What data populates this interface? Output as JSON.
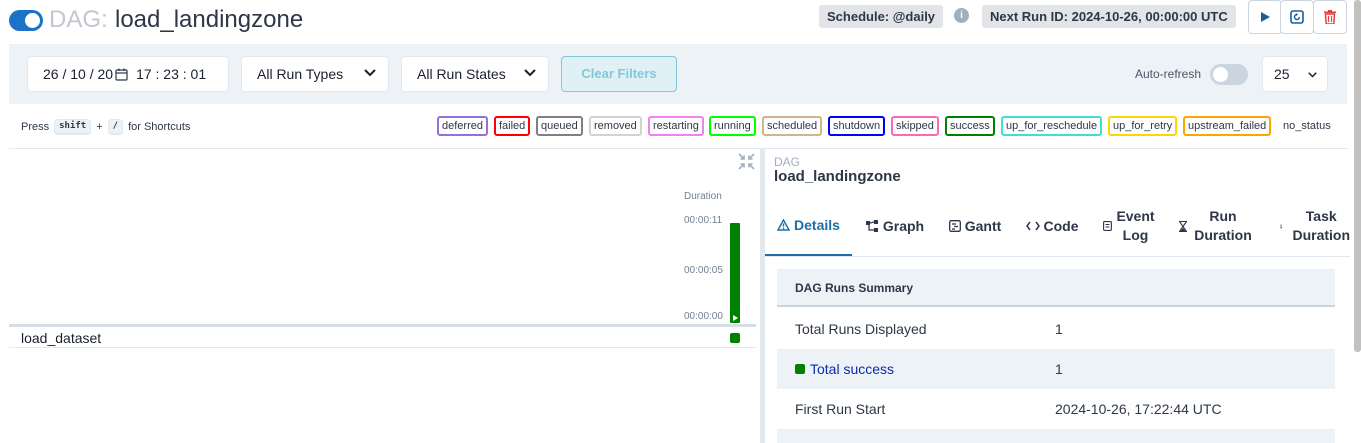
{
  "header": {
    "dag_prefix": "DAG:",
    "dag_name": "load_landingzone",
    "schedule": "Schedule: @daily",
    "next_run": "Next Run ID: 2024-10-26, 00:00:00 UTC",
    "info_glyph": "i",
    "icons": [
      "play-icon",
      "refresh-icon",
      "trash-icon"
    ]
  },
  "filters": {
    "date_value": "26 / 10 / 20",
    "time_value": "17 : 23 : 01",
    "run_types": "All Run Types",
    "run_states": "All Run States",
    "clear": "Clear Filters",
    "auto_refresh": "Auto-refresh",
    "page_size": "25"
  },
  "shortcuts": {
    "prefix": "Press",
    "key1": "shift",
    "plus": "+",
    "key2": "/",
    "suffix": "for Shortcuts"
  },
  "legend": [
    {
      "label": "deferred",
      "color": "#9370db"
    },
    {
      "label": "failed",
      "color": "#ff0000"
    },
    {
      "label": "queued",
      "color": "#808080"
    },
    {
      "label": "removed",
      "color": "#d3d3d3"
    },
    {
      "label": "restarting",
      "color": "#ee82ee"
    },
    {
      "label": "running",
      "color": "#00ff00"
    },
    {
      "label": "scheduled",
      "color": "#d2b48c"
    },
    {
      "label": "shutdown",
      "color": "#0000ff"
    },
    {
      "label": "skipped",
      "color": "#ff69b4"
    },
    {
      "label": "success",
      "color": "#008000"
    },
    {
      "label": "up_for_reschedule",
      "color": "#40e0d0"
    },
    {
      "label": "up_for_retry",
      "color": "#ffd700"
    },
    {
      "label": "upstream_failed",
      "color": "#ffa500"
    }
  ],
  "no_status": "no_status",
  "grid": {
    "duration_label": "Duration",
    "ticks": [
      "00:00:11",
      "00:00:05",
      "00:00:00"
    ],
    "run_duration_fraction": 1.0,
    "tasks": [
      {
        "name": "load_dataset",
        "state": "success"
      }
    ]
  },
  "details": {
    "crumb_label": "DAG",
    "crumb_name": "load_landingzone",
    "tabs": [
      {
        "label": "Details",
        "icon": "warning-icon"
      },
      {
        "label": "Graph",
        "icon": "graph-icon"
      },
      {
        "label": "Gantt",
        "icon": "gantt-icon"
      },
      {
        "label": "Code",
        "icon": "code-icon"
      },
      {
        "label": "Event Log",
        "icon": "log-icon"
      },
      {
        "label": "Run Duration",
        "icon": "hourglass-icon"
      },
      {
        "label": "Task Duration",
        "icon": "hourglass-icon"
      }
    ],
    "table_title": "DAG Runs Summary",
    "rows": [
      {
        "key": "Total Runs Displayed",
        "value": "1"
      },
      {
        "key": "Total success",
        "value": "1"
      },
      {
        "key": "First Run Start",
        "value": "2024-10-26, 17:22:44 UTC"
      }
    ]
  }
}
